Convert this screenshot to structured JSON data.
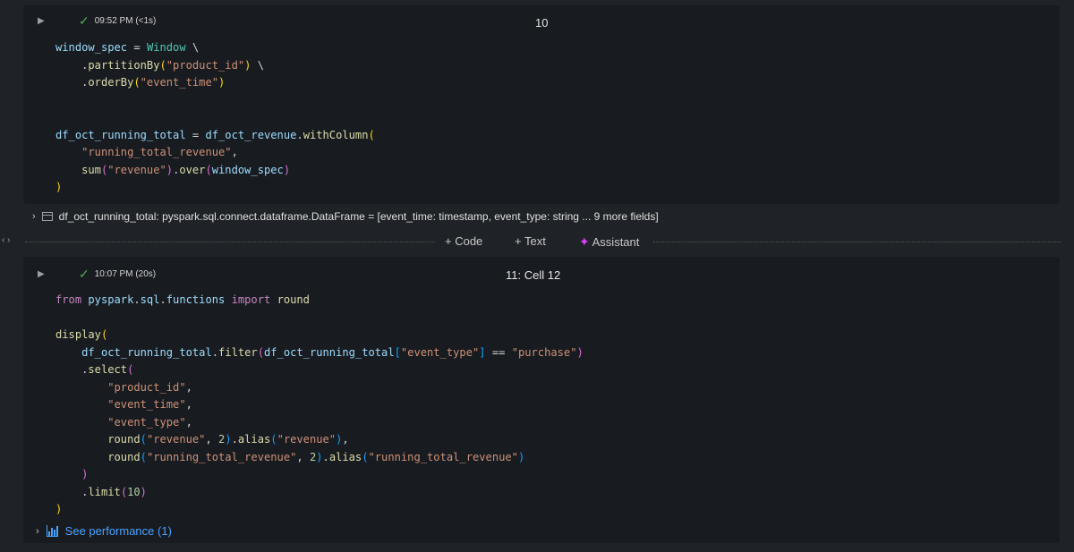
{
  "cell1": {
    "status_time": "09:52 PM (<1s)",
    "title": "10",
    "output": {
      "text": "df_oct_running_total:  pyspark.sql.connect.dataframe.DataFrame = [event_time: timestamp, event_type: string ... 9 more fields]"
    }
  },
  "toolbar": {
    "code_label": "+ Code",
    "text_label": "+ Text",
    "assistant_label": "Assistant"
  },
  "cell2": {
    "status_time": "10:07 PM (20s)",
    "title": "11:  Cell 12",
    "performance_label": "See performance (1)"
  },
  "colors": {
    "background": "#1f2226",
    "cell_background": "#181b20",
    "success": "#4caf50",
    "link": "#4aa3ff",
    "assistant_accent": "#e040fb"
  },
  "icons": [
    "run-icon",
    "check-icon",
    "chevron-right-icon",
    "dataframe-icon",
    "bar-chart-icon",
    "sparkle-icon",
    "nav-arrows-icon"
  ]
}
